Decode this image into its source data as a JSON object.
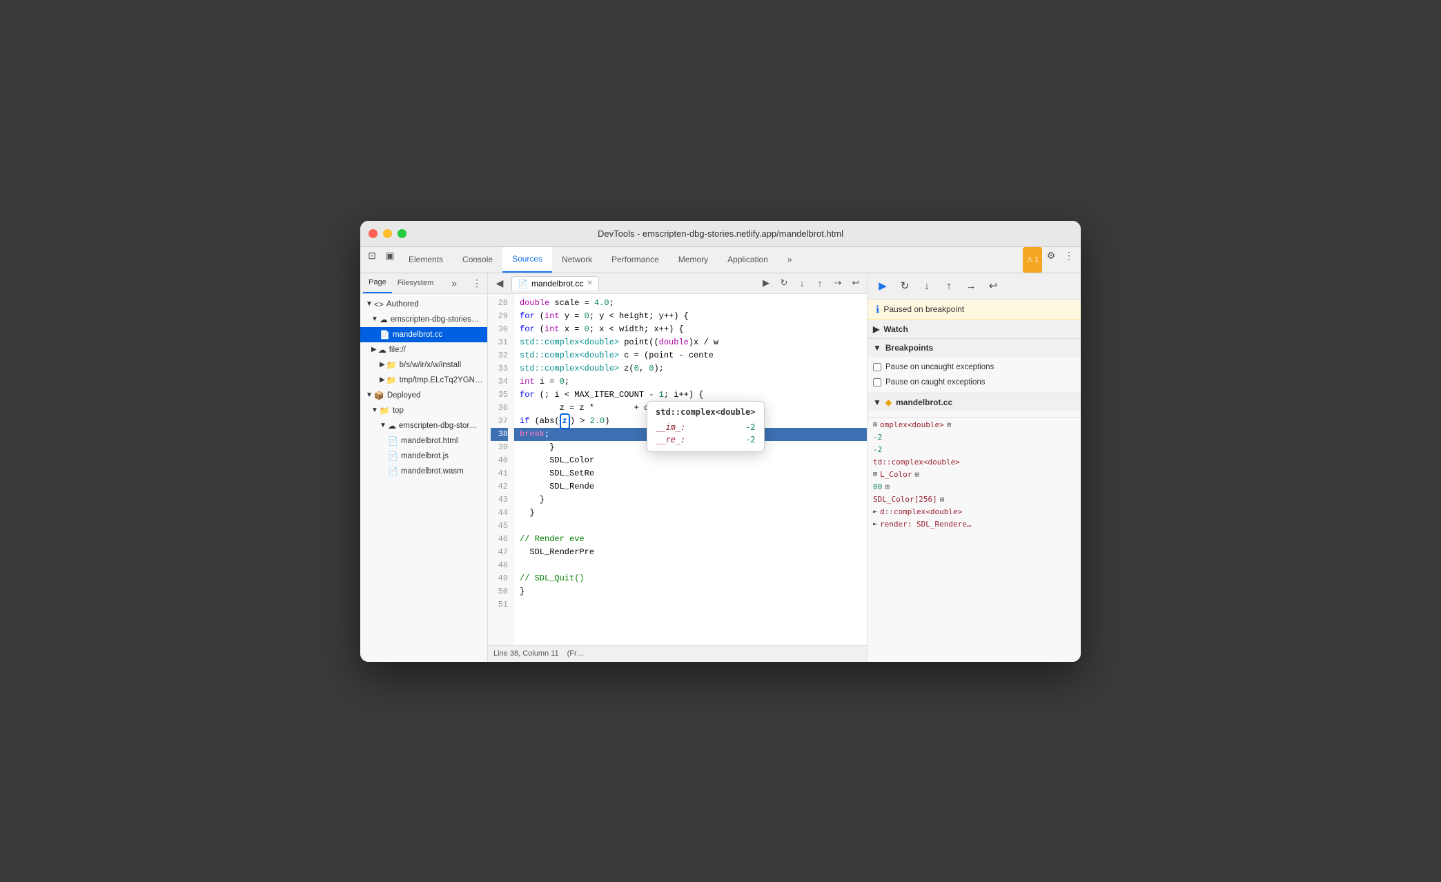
{
  "window": {
    "title": "DevTools - emscripten-dbg-stories.netlify.app/mandelbrot.html"
  },
  "tabs": [
    {
      "label": "Elements",
      "active": false
    },
    {
      "label": "Console",
      "active": false
    },
    {
      "label": "Sources",
      "active": true
    },
    {
      "label": "Network",
      "active": false
    },
    {
      "label": "Performance",
      "active": false
    },
    {
      "label": "Memory",
      "active": false
    },
    {
      "label": "Application",
      "active": false
    }
  ],
  "sidebar": {
    "tabs": [
      "Page",
      "Filesystem"
    ],
    "active_tab": "Page",
    "file_tree": [
      {
        "label": "Authored",
        "indent": 0,
        "type": "arrow-folder",
        "expanded": true
      },
      {
        "label": "emscripten-dbg-stories…",
        "indent": 1,
        "type": "cloud",
        "expanded": true
      },
      {
        "label": "mandelbrot.cc",
        "indent": 2,
        "type": "file",
        "selected": true
      },
      {
        "label": "file://",
        "indent": 1,
        "type": "cloud",
        "expanded": false
      },
      {
        "label": "b/s/w/ir/x/w/install",
        "indent": 2,
        "type": "folder",
        "expanded": false
      },
      {
        "label": "tmp/tmp.ELcTq2YGN…",
        "indent": 2,
        "type": "folder",
        "expanded": false
      },
      {
        "label": "Deployed",
        "indent": 0,
        "type": "arrow-folder",
        "expanded": true
      },
      {
        "label": "top",
        "indent": 1,
        "type": "folder",
        "expanded": true
      },
      {
        "label": "emscripten-dbg-stor…",
        "indent": 2,
        "type": "cloud",
        "expanded": true
      },
      {
        "label": "mandelbrot.html",
        "indent": 3,
        "type": "file"
      },
      {
        "label": "mandelbrot.js",
        "indent": 3,
        "type": "file"
      },
      {
        "label": "mandelbrot.wasm",
        "indent": 3,
        "type": "file"
      }
    ]
  },
  "editor": {
    "filename": "mandelbrot.cc",
    "lines": [
      {
        "num": 28,
        "code": "  double scale = 4.0;"
      },
      {
        "num": 29,
        "code": "  for (int y = 0; y < height; y++) {"
      },
      {
        "num": 30,
        "code": "    for (int x = 0; x < width; x++) {"
      },
      {
        "num": 31,
        "code": "      std::complex<double> point((double)x / w"
      },
      {
        "num": 32,
        "code": "      std::complex<double> c = (point - cente"
      },
      {
        "num": 33,
        "code": "      std::complex<double> z(0, 0);"
      },
      {
        "num": 34,
        "code": "      int i = 0;"
      },
      {
        "num": 35,
        "code": "      for (; i < MAX_ITER_COUNT - 1; i++) {"
      },
      {
        "num": 36,
        "code": "        z = z *        + c;"
      },
      {
        "num": 37,
        "code": "        if (abs(      > 2.0)"
      },
      {
        "num": 38,
        "code": "          break;",
        "highlighted": true
      },
      {
        "num": 39,
        "code": "      }"
      },
      {
        "num": 40,
        "code": "      SDL_Color"
      },
      {
        "num": 41,
        "code": "      SDL_SetRe"
      },
      {
        "num": 42,
        "code": "      SDL_Rende"
      },
      {
        "num": 43,
        "code": "    }"
      },
      {
        "num": 44,
        "code": "  }"
      },
      {
        "num": 45,
        "code": ""
      },
      {
        "num": 46,
        "code": "  // Render eve"
      },
      {
        "num": 47,
        "code": "  SDL_RenderPre"
      },
      {
        "num": 48,
        "code": ""
      },
      {
        "num": 49,
        "code": "  // SDL_Quit()"
      },
      {
        "num": 50,
        "code": "}"
      },
      {
        "num": 51,
        "code": ""
      }
    ],
    "status_line": "Line 38, Column 11",
    "status_extra": "(Fr…"
  },
  "tooltip": {
    "title": "std::complex<double>",
    "fields": [
      {
        "key": "__im_:",
        "value": "-2"
      },
      {
        "key": "__re_:",
        "value": "-2"
      }
    ]
  },
  "right_panel": {
    "paused_message": "Paused on breakpoint",
    "sections": [
      {
        "label": "Watch",
        "expanded": false,
        "arrow": "▶"
      },
      {
        "label": "Breakpoints",
        "expanded": true,
        "arrow": "▼",
        "items": [
          {
            "text": "Pause on uncaught exceptions"
          },
          {
            "text": "Pause on caught exceptions"
          },
          {
            "file": "mandelbrot.cc",
            "line": 38
          }
        ]
      }
    ],
    "call_stack": [
      {
        "fn": "mandelbrot.cc",
        "line": "38"
      }
    ],
    "scope_vars": [
      {
        "type": "omplex<double>",
        "icon": "⊞"
      },
      {
        "val": "-2"
      },
      {
        "val": "-2"
      },
      {
        "type": "td::complex<double>"
      },
      {
        "type": "L_Color",
        "icon": "⊞"
      },
      {
        "val": "00",
        "icon": "⊞"
      },
      {
        "type": "SDL_Color[256]",
        "icon": "⊞"
      },
      {
        "type": "d::complex<double>",
        "icon": "►"
      },
      {
        "type": "render: SDL_Rendere…",
        "icon": "►"
      }
    ]
  }
}
